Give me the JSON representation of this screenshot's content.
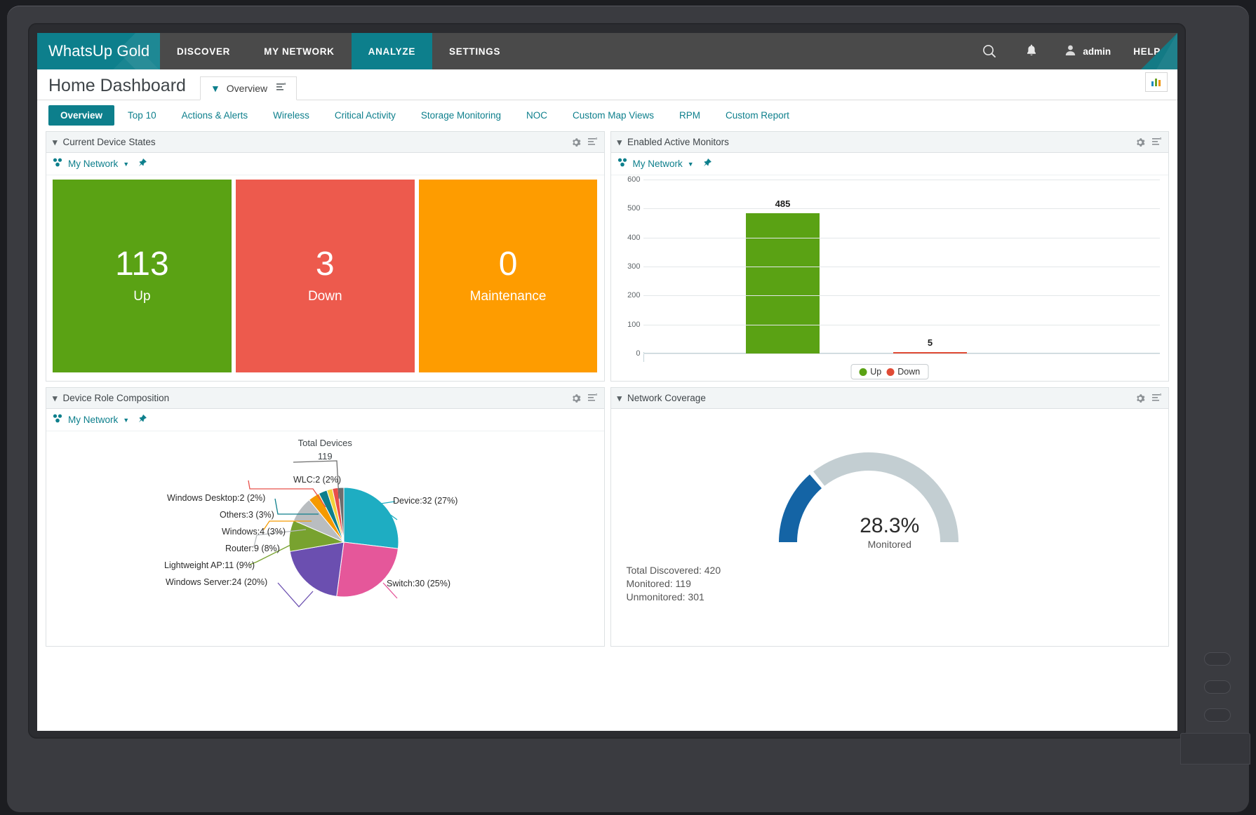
{
  "app": {
    "brand": "WhatsUp Gold",
    "nav": [
      {
        "label": "DISCOVER",
        "active": false
      },
      {
        "label": "MY NETWORK",
        "active": false
      },
      {
        "label": "ANALYZE",
        "active": true
      },
      {
        "label": "SETTINGS",
        "active": false
      }
    ],
    "search_icon": "search-icon",
    "alerts_icon": "bell-icon",
    "user": "admin",
    "help": "HELP",
    "accent": "#0d7f8c"
  },
  "dashboard": {
    "title": "Home Dashboard",
    "tab": "Overview",
    "subtabs": [
      {
        "label": "Overview",
        "active": true
      },
      {
        "label": "Top 10",
        "active": false
      },
      {
        "label": "Actions & Alerts",
        "active": false
      },
      {
        "label": "Wireless",
        "active": false
      },
      {
        "label": "Critical Activity",
        "active": false
      },
      {
        "label": "Storage Monitoring",
        "active": false
      },
      {
        "label": "NOC",
        "active": false
      },
      {
        "label": "Custom Map Views",
        "active": false
      },
      {
        "label": "RPM",
        "active": false
      },
      {
        "label": "Custom Report",
        "active": false
      }
    ]
  },
  "panels": {
    "device_states": {
      "title": "Current Device States",
      "scope": "My Network",
      "tiles": [
        {
          "value": "113",
          "label": "Up",
          "color": "#5aa214"
        },
        {
          "value": "3",
          "label": "Down",
          "color": "#ed5a4d"
        },
        {
          "value": "0",
          "label": "Maintenance",
          "color": "#fe9c00"
        }
      ]
    },
    "active_monitors": {
      "title": "Enabled Active Monitors",
      "scope": "My Network"
    },
    "device_roles": {
      "title": "Device Role Composition",
      "scope": "My Network",
      "total_caption": "Total Devices",
      "total_value": "119"
    },
    "network_coverage": {
      "title": "Network Coverage",
      "percent_label": "28.3%",
      "percent_caption": "Monitored",
      "stats": [
        "Total Discovered: 420",
        "Monitored: 119",
        "Unmonitored: 301"
      ],
      "arc_color": "#1464a5",
      "track_color": "#c3ced2",
      "percent_value": 28.3
    }
  },
  "chart_data": [
    {
      "id": "enabled-active-monitors",
      "type": "bar",
      "title": "Enabled Active Monitors",
      "categories": [
        "Up",
        "Down"
      ],
      "values": [
        485,
        5
      ],
      "colors": [
        "#5aa214",
        "#e04b35"
      ],
      "data_labels": [
        "485",
        "5"
      ],
      "xlabel": "",
      "ylabel": "",
      "ylim": [
        0,
        600
      ],
      "yticks": [
        0,
        100,
        200,
        300,
        400,
        500,
        600
      ],
      "grid": true,
      "legend": [
        "Up",
        "Down"
      ],
      "legend_position": "bottom-center"
    },
    {
      "id": "device-role-composition",
      "type": "pie",
      "title": "Device Role Composition",
      "total_label": "Total Devices",
      "total": 119,
      "slices": [
        {
          "name": "Device",
          "value": 32,
          "percent": 27,
          "label": "Device:32 (27%)",
          "color": "#1eadc2"
        },
        {
          "name": "Switch",
          "value": 30,
          "percent": 25,
          "label": "Switch:30 (25%)",
          "color": "#e5579a"
        },
        {
          "name": "Windows Server",
          "value": 24,
          "percent": 20,
          "label": "Windows Server:24 (20%)",
          "color": "#6b4fb0"
        },
        {
          "name": "Lightweight AP",
          "value": 11,
          "percent": 9,
          "label": "Lightweight AP:11 (9%)",
          "color": "#78a22f"
        },
        {
          "name": "Router",
          "value": 9,
          "percent": 8,
          "label": "Router:9 (8%)",
          "color": "#b9bdc0"
        },
        {
          "name": "Windows",
          "value": 4,
          "percent": 3,
          "label": "Windows:4 (3%)",
          "color": "#f59a00"
        },
        {
          "name": "Others",
          "value": 3,
          "percent": 3,
          "label": "Others:3 (3%)",
          "color": "#0d7f8c"
        },
        {
          "name": "Windows Desktop",
          "value": 2,
          "percent": 2,
          "label": "Windows Desktop:2 (2%)",
          "color": "#f2d23a"
        },
        {
          "name": "WLC",
          "value": 2,
          "percent": 2,
          "label": "WLC:2 (2%)",
          "color": "#e8504a"
        },
        {
          "name": "Unlabeled",
          "value": 2,
          "percent": 1,
          "label": "",
          "color": "#6d6d6d"
        }
      ]
    },
    {
      "id": "network-coverage",
      "type": "gauge",
      "title": "Network Coverage",
      "value": 28.3,
      "unit": "%",
      "caption": "Monitored",
      "min": 0,
      "max": 100,
      "total_discovered": 420,
      "monitored": 119,
      "unmonitored": 301
    }
  ]
}
